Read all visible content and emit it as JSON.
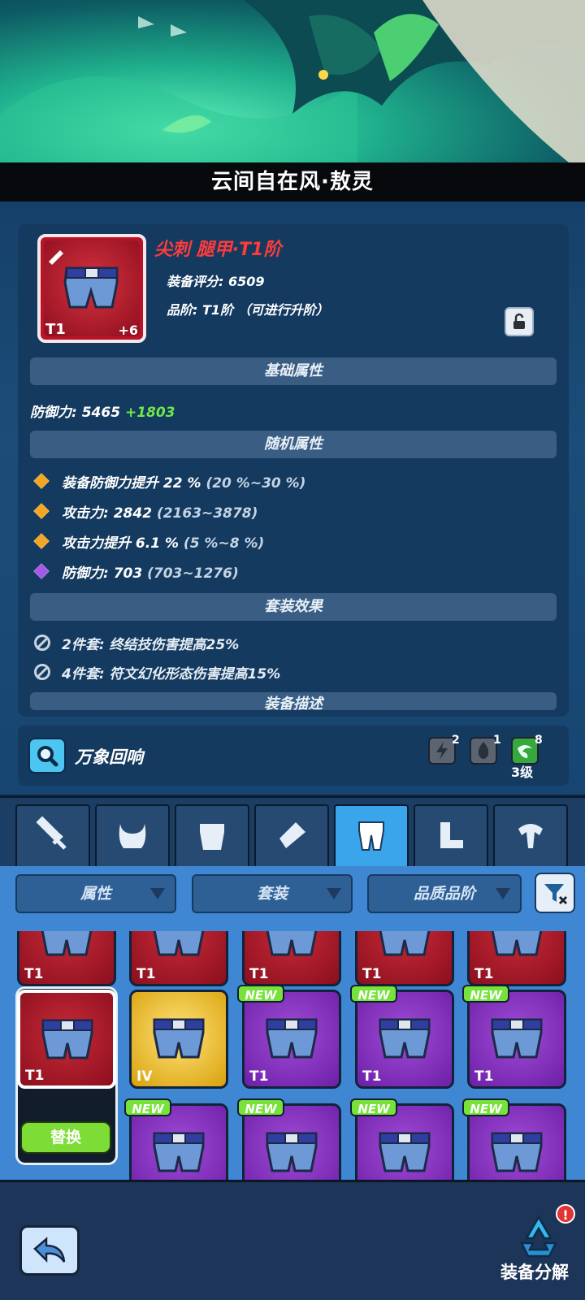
{
  "hero": {
    "title": "云间自在风·敖灵"
  },
  "item": {
    "name": "尖刺 腿甲·T1阶",
    "tier": "T1",
    "enhance": "+6",
    "score_line": "装备评分: 6509",
    "grade_line": "品阶: T1阶 （可进行升阶）"
  },
  "sections": {
    "base": "基础属性",
    "random": "随机属性",
    "set": "套装效果",
    "desc": "装备描述"
  },
  "base_stat": {
    "label": "防御力: 5465",
    "bonus": "+1803"
  },
  "random_stats": [
    {
      "text": "装备防御力提升 22 %",
      "range": "(20 %~30 %)",
      "color": "#f2a623"
    },
    {
      "text": "攻击力: 2842",
      "range": "(2163~3878)",
      "color": "#f2a623"
    },
    {
      "text": "攻击力提升 6.1 %",
      "range": "(5 %~8 %)",
      "color": "#f2a623"
    },
    {
      "text": "防御力: 703",
      "range": "(703~1276)",
      "color": "#a45ae6"
    }
  ],
  "set_effects": [
    "2件套: 终结技伤害提高25%",
    "4件套: 符文幻化形态伤害提高15%"
  ],
  "echo": {
    "label": "万象回响",
    "runes": [
      {
        "count": "2"
      },
      {
        "count": "1"
      },
      {
        "count": "8"
      }
    ],
    "level": "3级"
  },
  "tabs": [
    "weapon-tab",
    "helmet-tab",
    "armor-tab",
    "gauntlet-tab",
    "legs-tab",
    "boots-tab",
    "accessory-tab"
  ],
  "filters": {
    "attribute": "属性",
    "set": "套装",
    "quality": "品质品阶"
  },
  "inventory": {
    "row1": [
      "T1",
      "T1",
      "T1",
      "T1",
      "T1"
    ],
    "row2": [
      {
        "tier": "T1",
        "rarity": "red",
        "new": ""
      },
      {
        "tier": "IV",
        "rarity": "gold",
        "new": ""
      },
      {
        "tier": "T1",
        "rarity": "purple",
        "new": "NEW"
      },
      {
        "tier": "T1",
        "rarity": "purple",
        "new": "NEW"
      },
      {
        "tier": "T1",
        "rarity": "purple",
        "new": "NEW"
      }
    ],
    "row3_new": [
      "NEW",
      "NEW",
      "NEW",
      "NEW"
    ],
    "replace_label": "替换"
  },
  "bottom": {
    "decompose_label": "装备分解",
    "alert": "!"
  }
}
